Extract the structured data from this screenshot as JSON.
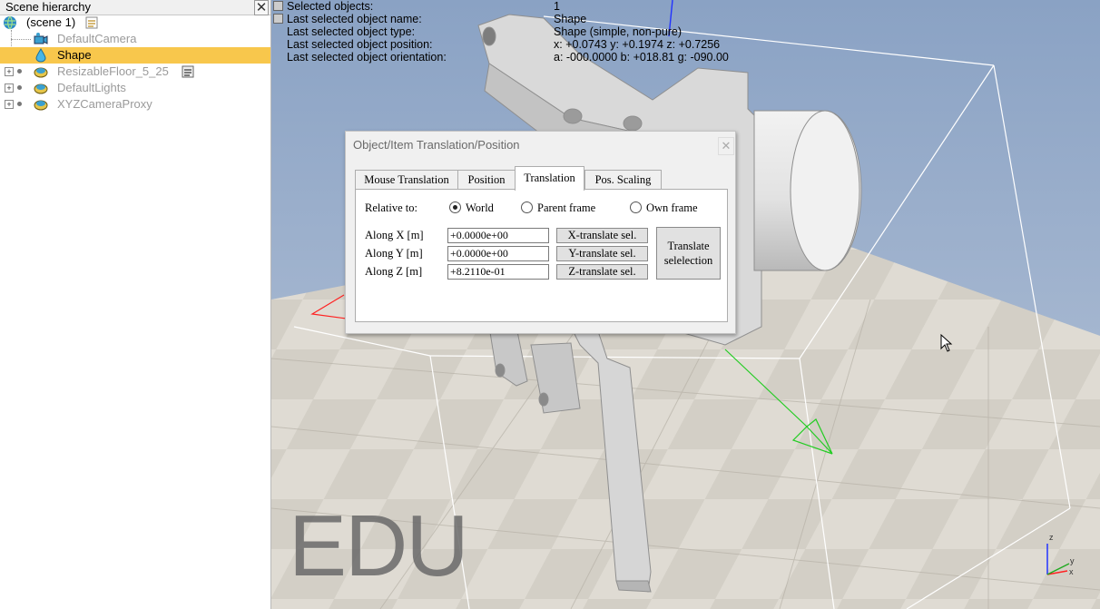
{
  "hierarchy": {
    "title": "Scene hierarchy",
    "close_glyph": "✕",
    "items": [
      {
        "label": "(scene 1)",
        "icon": "globe-icon",
        "selected": false,
        "dimmed": false
      },
      {
        "label": "DefaultCamera",
        "icon": "camera-icon",
        "selected": false,
        "dimmed": true
      },
      {
        "label": "Shape",
        "icon": "shape-drop-icon",
        "selected": true,
        "dimmed": false
      },
      {
        "label": "ResizableFloor_5_25",
        "icon": "floor-icon",
        "selected": false,
        "dimmed": true
      },
      {
        "label": "DefaultLights",
        "icon": "lights-icon",
        "selected": false,
        "dimmed": true
      },
      {
        "label": "XYZCameraProxy",
        "icon": "proxy-icon",
        "selected": false,
        "dimmed": true
      }
    ]
  },
  "info": {
    "rows": [
      {
        "key": "Selected objects:",
        "value": "1"
      },
      {
        "key": "Last selected object name:",
        "value": "Shape"
      },
      {
        "key": "Last selected object type:",
        "value": "Shape (simple, non-pure)"
      },
      {
        "key": "Last selected object position:",
        "value": "x: +0.0743    y: +0.1974    z: +0.7256"
      },
      {
        "key": "Last selected object orientation:",
        "value": "a: -000.0000    b: +018.81    g: -090.00"
      }
    ]
  },
  "watermark": "EDU",
  "axes_gizmo": {
    "x": "x",
    "y": "y",
    "z": "z"
  },
  "dialog": {
    "title": "Object/Item Translation/Position",
    "close_glyph": "✕",
    "tabs": [
      "Mouse Translation",
      "Position",
      "Translation",
      "Pos. Scaling"
    ],
    "active_tab": "Translation",
    "relative_to_label": "Relative to:",
    "relative_options": [
      "World",
      "Parent frame",
      "Own frame"
    ],
    "relative_selected": "World",
    "fields": [
      {
        "label": "Along X [m]",
        "value": "+0.0000e+00",
        "button": "X-translate sel."
      },
      {
        "label": "Along Y [m]",
        "value": "+0.0000e+00",
        "button": "Y-translate sel."
      },
      {
        "label": "Along Z [m]",
        "value": "+8.2110e-01",
        "button": "Z-translate sel."
      }
    ],
    "translate_button_line1": "Translate",
    "translate_button_line2": "selelection"
  },
  "colors": {
    "selection": "#f8c74c",
    "sky_top": "#8aa2c4",
    "sky_bottom": "#b9c6d9"
  }
}
